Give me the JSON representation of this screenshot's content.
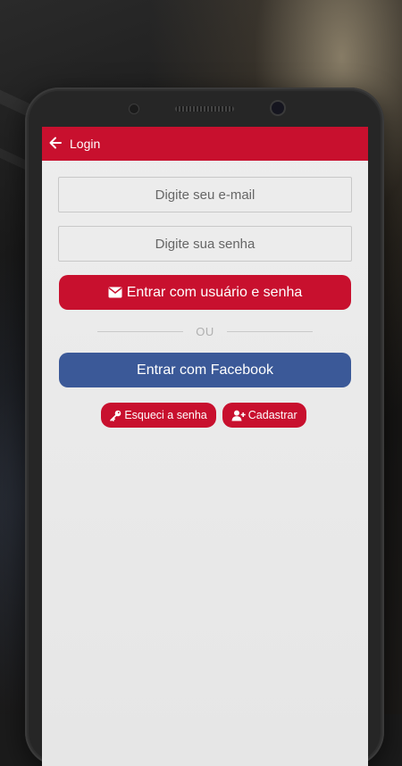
{
  "appbar": {
    "title": "Login"
  },
  "form": {
    "email_placeholder": "Digite seu e-mail",
    "password_placeholder": "Digite sua senha",
    "login_button": "Entrar com usuário e senha",
    "divider": "OU",
    "facebook_button": "Entrar com Facebook",
    "forgot_button": "Esqueci a senha",
    "register_button": "Cadastrar"
  },
  "colors": {
    "brand": "#c8102e",
    "facebook": "#3b5998",
    "screen_bg": "#e9e9e9"
  },
  "icons": {
    "back": "arrow-left-icon",
    "login": "envelope-icon",
    "forgot": "key-icon",
    "register": "user-plus-icon"
  }
}
